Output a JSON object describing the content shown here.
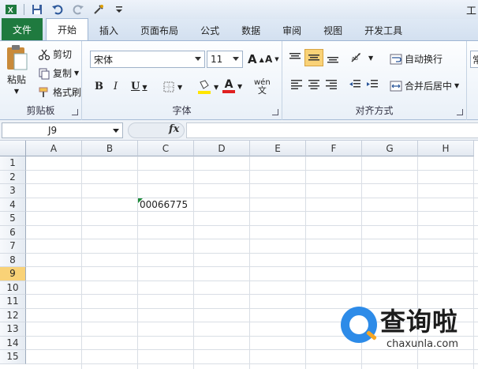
{
  "title_fragment": "工",
  "quick_access": {
    "icons": [
      "excel-icon",
      "save-icon",
      "undo-icon",
      "redo-icon",
      "format-icon",
      "customize-icon"
    ]
  },
  "tabs": [
    "文件",
    "开始",
    "插入",
    "页面布局",
    "公式",
    "数据",
    "审阅",
    "视图",
    "开发工具"
  ],
  "active_tab": "开始",
  "ribbon": {
    "clipboard": {
      "paste": "粘贴",
      "cut": "剪切",
      "copy": "复制",
      "format_painter": "格式刷",
      "label": "剪贴板"
    },
    "font": {
      "name": "宋体",
      "size": "11",
      "grow": "A",
      "shrink": "A",
      "bold": "B",
      "italic": "I",
      "underline": "U",
      "font_color": "A",
      "phonetic": "wén",
      "label": "字体"
    },
    "alignment": {
      "wrap_text": "自动换行",
      "merge_center": "合并后居中",
      "label": "对齐方式"
    },
    "next_fragment": "常"
  },
  "formula_bar": {
    "name_box": "J9",
    "fx": "fx",
    "formula": ""
  },
  "columns": [
    "A",
    "B",
    "C",
    "D",
    "E",
    "F",
    "G",
    "H"
  ],
  "rows": [
    "1",
    "2",
    "3",
    "4",
    "5",
    "6",
    "7",
    "8",
    "9",
    "10",
    "11",
    "12",
    "13",
    "14",
    "15"
  ],
  "selected_row": "9",
  "cells": [
    {
      "ref": "C4",
      "value": "00066775"
    }
  ],
  "watermark": {
    "text": "查询啦",
    "url": "chaxunla.com"
  },
  "colors": {
    "file_tab": "#1f7a3f",
    "error_indicator": "#1e8c3a",
    "row_highlight": "#f9d277",
    "watermark_blue": "#2d8be8"
  }
}
